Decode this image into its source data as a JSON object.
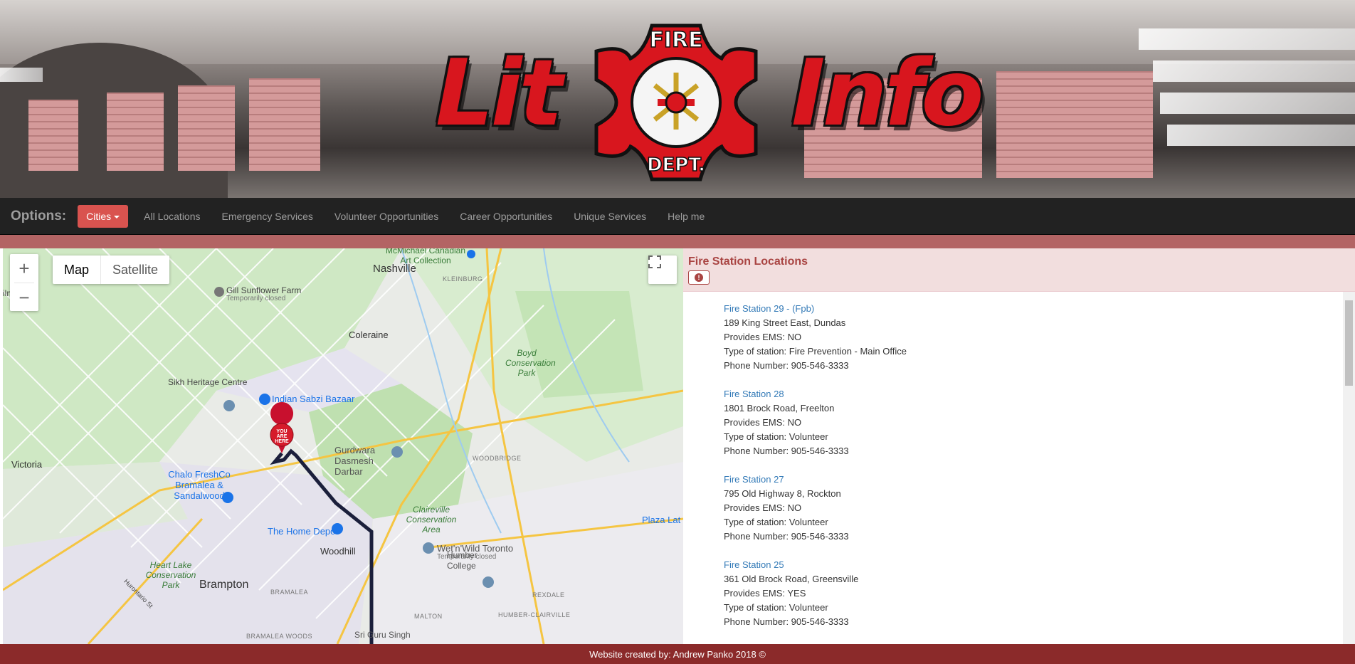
{
  "banner": {
    "word_left": "Lit",
    "word_right": "Info",
    "logo_top": "FIRE",
    "logo_bottom": "DEPT."
  },
  "nav": {
    "brand": "Options:",
    "cities": "Cities",
    "links": [
      "All Locations",
      "Emergency Services",
      "Volunteer Opportunities",
      "Career Opportunities",
      "Unique Services",
      "Help me"
    ]
  },
  "map": {
    "map_button": "Map",
    "satellite_button": "Satellite",
    "zoom_in": "+",
    "zoom_out": "−",
    "marker_label": "YOU ARE HERE",
    "places": {
      "nashville": "Nashville",
      "mcmichael": "McMichael Canadian Art Collection",
      "kleinburg": "KLEINBURG",
      "gill": "Gill Sunflower Farm",
      "gill_sub": "Temporarily closed",
      "coleraine": "Coleraine",
      "boyd": "Boyd Conservation Park",
      "sikh": "Sikh Heritage Centre",
      "indian": "Indian Sabzi Bazaar",
      "victoria": "Victoria",
      "gurdwara": "Gurdwara Dasmesh Darbar",
      "woodbridge": "WOODBRIDGE",
      "chalo": "Chalo FreshCo Bramalea & Sandalwood",
      "claireville": "Claireville Conservation Area",
      "plaza": "Plaza Lat",
      "homedepot": "The Home Depot",
      "woodhill": "Woodhill",
      "wetnwild": "Wet'n'Wild Toronto",
      "wetnwild_sub": "Temporarily closed",
      "heartlake": "Heart Lake Conservation Park",
      "brampton": "Brampton",
      "bramalea": "BRAMALEA",
      "humber": "Humber College",
      "rexdale": "REXDALE",
      "malton": "MALTON",
      "humberclair": "HUMBER-CLAIRVILLE",
      "hurontario": "Hurontario St",
      "srigurusingh": "Sri Guru Singh",
      "bramaleawoods": "BRAMALEA WOODS",
      "leftedge": "ilm  h"
    }
  },
  "panel": {
    "title": "Fire Station Locations",
    "stations": [
      {
        "name": "Fire Station 29 - (Fpb)",
        "address": "189 King Street East, Dundas",
        "ems": "Provides EMS: NO",
        "type": "Type of station: Fire Prevention - Main Office",
        "phone": "Phone Number: 905-546-3333"
      },
      {
        "name": "Fire Station 28",
        "address": "1801 Brock Road, Freelton",
        "ems": "Provides EMS: NO",
        "type": "Type of station: Volunteer",
        "phone": "Phone Number: 905-546-3333"
      },
      {
        "name": "Fire Station 27",
        "address": "795 Old Highway 8, Rockton",
        "ems": "Provides EMS: NO",
        "type": "Type of station: Volunteer",
        "phone": "Phone Number: 905-546-3333"
      },
      {
        "name": "Fire Station 25",
        "address": "361 Old Brock Road, Greensville",
        "ems": "Provides EMS: YES",
        "type": "Type of station: Volunteer",
        "phone": "Phone Number: 905-546-3333"
      }
    ]
  },
  "footer": "Website created by: Andrew Panko 2018 ©",
  "colors": {
    "nav_bg": "#222222",
    "cities_btn": "#d9534f",
    "panel_head_bg": "#f2dede",
    "panel_title": "#a94442",
    "link": "#337ab7",
    "footer_bg": "#8b2a2a",
    "route": "#1b1f3b"
  }
}
